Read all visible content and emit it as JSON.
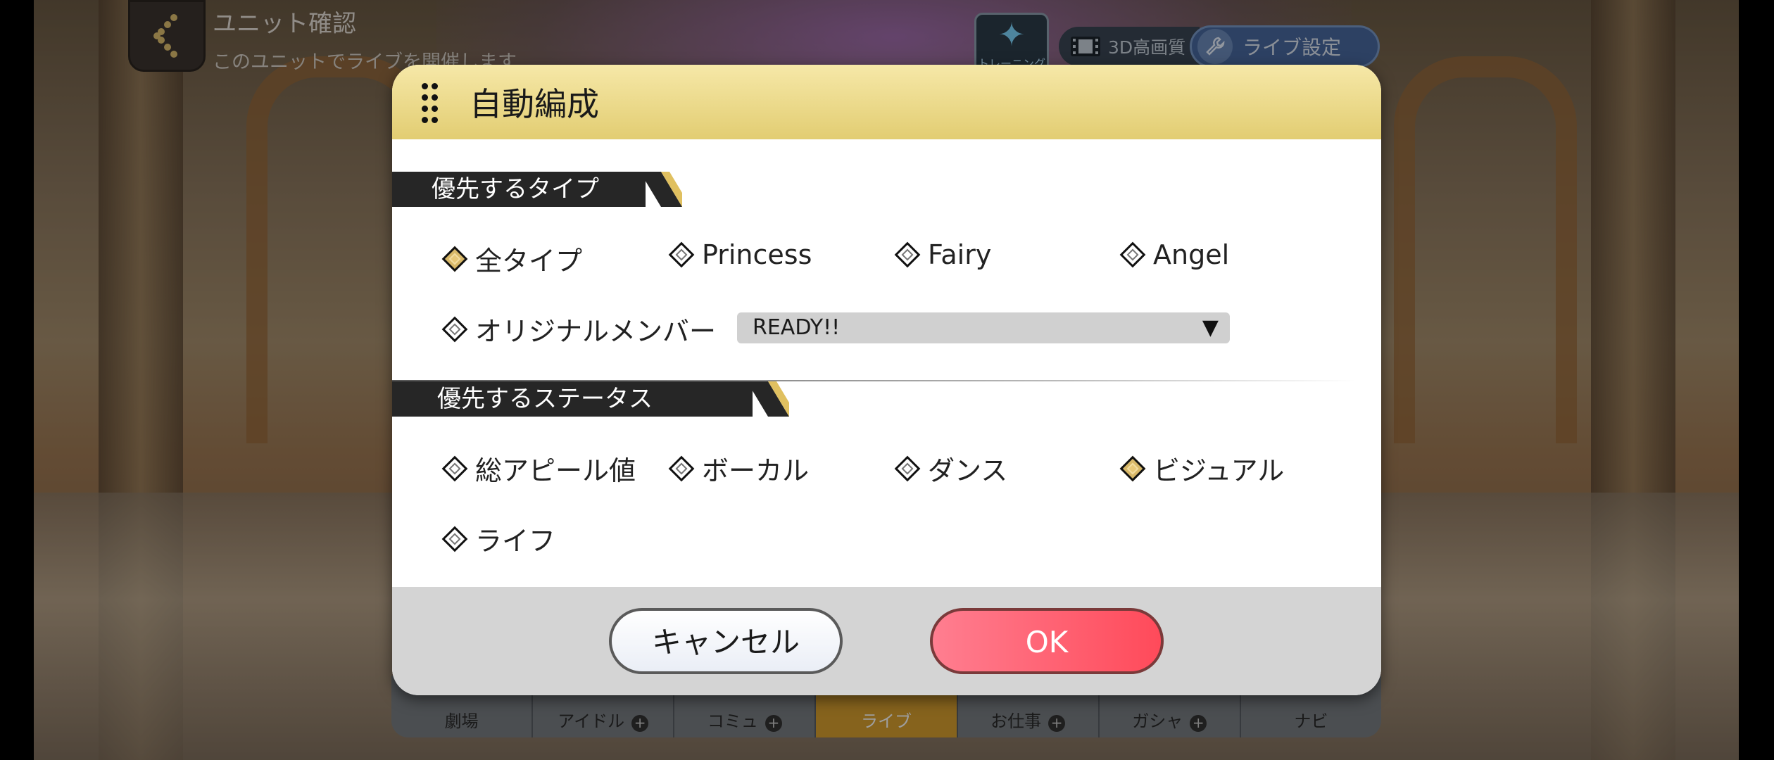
{
  "header": {
    "title": "ユニット確認",
    "subtitle": "このユニットでライブを開催します",
    "training_label": "トレーニング",
    "hq_label": "3D高画質",
    "live_setting_label": "ライブ設定"
  },
  "nav": {
    "items": [
      {
        "label": "劇場",
        "plus": false,
        "active": false
      },
      {
        "label": "アイドル",
        "plus": true,
        "active": false
      },
      {
        "label": "コミュ",
        "plus": true,
        "active": false
      },
      {
        "label": "ライブ",
        "plus": false,
        "active": true
      },
      {
        "label": "お仕事",
        "plus": true,
        "active": false
      },
      {
        "label": "ガシャ",
        "plus": true,
        "active": false
      },
      {
        "label": "ナビ",
        "plus": false,
        "active": false
      }
    ],
    "plus_symbol": "+"
  },
  "dialog": {
    "title": "自動編成",
    "type_section": {
      "label": "優先するタイプ",
      "options": [
        {
          "label": "全タイプ",
          "selected": true
        },
        {
          "label": "Princess",
          "selected": false
        },
        {
          "label": "Fairy",
          "selected": false
        },
        {
          "label": "Angel",
          "selected": false
        },
        {
          "label": "オリジナルメンバー",
          "selected": false
        }
      ],
      "member_select": {
        "value": "READY!!",
        "arrow": "▼"
      }
    },
    "status_section": {
      "label": "優先するステータス",
      "options": [
        {
          "label": "総アピール値",
          "selected": false
        },
        {
          "label": "ボーカル",
          "selected": false
        },
        {
          "label": "ダンス",
          "selected": false
        },
        {
          "label": "ビジュアル",
          "selected": true
        },
        {
          "label": "ライフ",
          "selected": false
        }
      ]
    },
    "buttons": {
      "cancel": "キャンセル",
      "ok": "OK"
    }
  },
  "colors": {
    "accent_gold": "#e2cd72",
    "ok_red": "#ff4a5a",
    "selected_diamond": "#d8b868"
  }
}
